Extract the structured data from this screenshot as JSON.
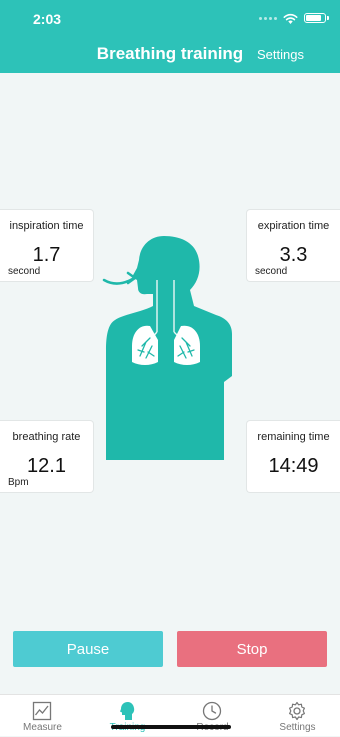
{
  "status_bar": {
    "time": "2:03"
  },
  "nav": {
    "title": "Breathing training",
    "settings_label": "Settings"
  },
  "cards": {
    "inspiration": {
      "label": "inspiration time",
      "value": "1.7",
      "unit": "second"
    },
    "expiration": {
      "label": "expiration time",
      "value": "3.3",
      "unit": "second"
    },
    "rate": {
      "label": "breathing rate",
      "value": "12.1",
      "unit": "Bpm"
    },
    "remaining": {
      "label": "remaining time",
      "value": "14:49"
    }
  },
  "figure": {
    "icon": "breathing-body-icon",
    "color": "#1fb8aa"
  },
  "actions": {
    "pause_label": "Pause",
    "stop_label": "Stop",
    "pause_color": "#4ecbd2",
    "stop_color": "#e9707f"
  },
  "tabs": [
    {
      "label": "Measure",
      "icon": "chart-icon",
      "active": false
    },
    {
      "label": "Training",
      "icon": "breath-icon",
      "active": true
    },
    {
      "label": "Record",
      "icon": "clock-icon",
      "active": false
    },
    {
      "label": "Settings",
      "icon": "gear-icon",
      "active": false
    }
  ],
  "theme": {
    "accent": "#2dc2b8"
  }
}
